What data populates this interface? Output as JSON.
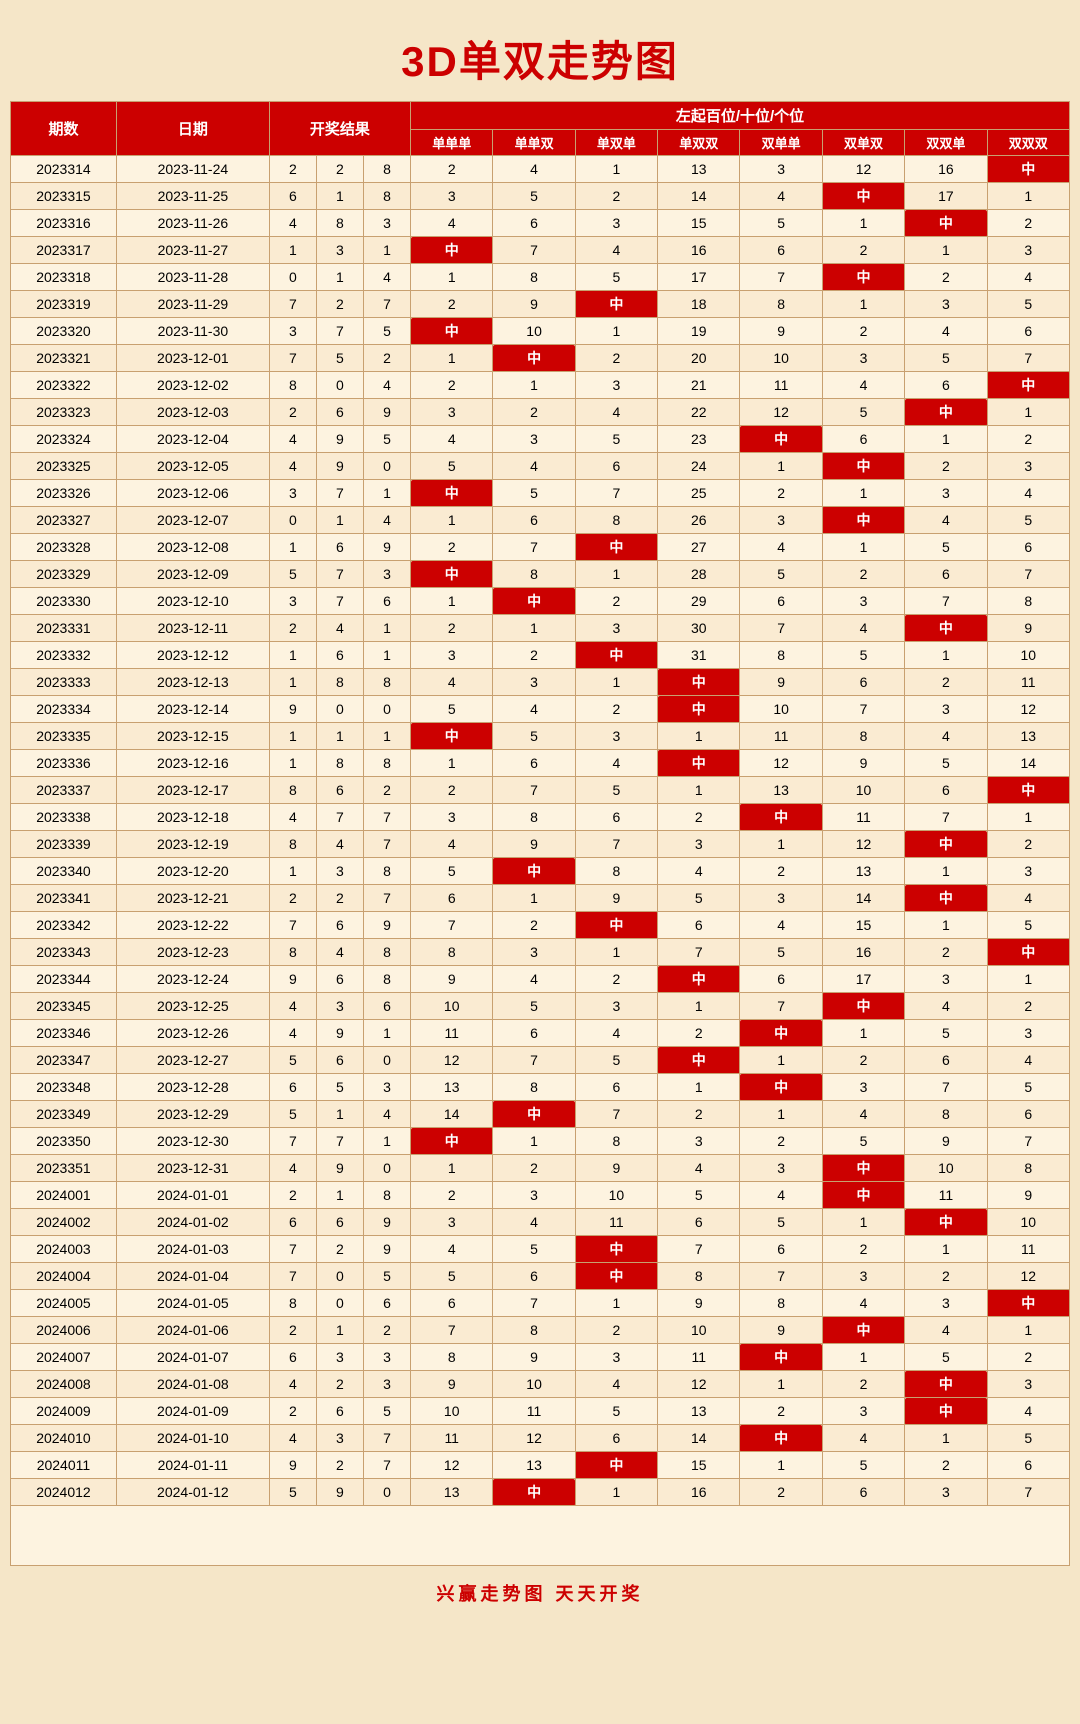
{
  "title": "3D单双走势图",
  "subtitle_left": "左起百位/十位/个位",
  "headers": {
    "qishu": "期数",
    "date": "日期",
    "result": "开奖结果",
    "cols": [
      "单单单",
      "单单双",
      "单双单",
      "单双双",
      "双单单",
      "双单双",
      "双双单",
      "双双双"
    ]
  },
  "footer": "兴赢走势图    天天开奖",
  "rows": [
    {
      "id": "2023314",
      "date": "2023-11-24",
      "r": [
        2,
        2,
        8
      ],
      "v": [
        2,
        4,
        1,
        13,
        3,
        12,
        16,
        "中"
      ]
    },
    {
      "id": "2023315",
      "date": "2023-11-25",
      "r": [
        6,
        1,
        8
      ],
      "v": [
        3,
        5,
        2,
        14,
        4,
        "中",
        17,
        1
      ]
    },
    {
      "id": "2023316",
      "date": "2023-11-26",
      "r": [
        4,
        8,
        3
      ],
      "v": [
        4,
        6,
        3,
        15,
        5,
        1,
        "中",
        2
      ]
    },
    {
      "id": "2023317",
      "date": "2023-11-27",
      "r": [
        1,
        3,
        1
      ],
      "v": [
        "中",
        7,
        4,
        16,
        6,
        2,
        1,
        3
      ]
    },
    {
      "id": "2023318",
      "date": "2023-11-28",
      "r": [
        0,
        1,
        4
      ],
      "v": [
        1,
        8,
        5,
        17,
        7,
        "中",
        2,
        4
      ]
    },
    {
      "id": "2023319",
      "date": "2023-11-29",
      "r": [
        7,
        2,
        7
      ],
      "v": [
        2,
        9,
        "中",
        18,
        8,
        1,
        3,
        5
      ]
    },
    {
      "id": "2023320",
      "date": "2023-11-30",
      "r": [
        3,
        7,
        5
      ],
      "v": [
        "中",
        10,
        1,
        19,
        9,
        2,
        4,
        6
      ]
    },
    {
      "id": "2023321",
      "date": "2023-12-01",
      "r": [
        7,
        5,
        2
      ],
      "v": [
        1,
        "中",
        2,
        20,
        10,
        3,
        5,
        7
      ]
    },
    {
      "id": "2023322",
      "date": "2023-12-02",
      "r": [
        8,
        0,
        4
      ],
      "v": [
        2,
        1,
        3,
        21,
        11,
        4,
        6,
        "中"
      ]
    },
    {
      "id": "2023323",
      "date": "2023-12-03",
      "r": [
        2,
        6,
        9
      ],
      "v": [
        3,
        2,
        4,
        22,
        12,
        5,
        "中",
        1
      ]
    },
    {
      "id": "2023324",
      "date": "2023-12-04",
      "r": [
        4,
        9,
        5
      ],
      "v": [
        4,
        3,
        5,
        23,
        "中",
        6,
        1,
        2
      ]
    },
    {
      "id": "2023325",
      "date": "2023-12-05",
      "r": [
        4,
        9,
        0
      ],
      "v": [
        5,
        4,
        6,
        24,
        1,
        "中",
        2,
        3
      ]
    },
    {
      "id": "2023326",
      "date": "2023-12-06",
      "r": [
        3,
        7,
        1
      ],
      "v": [
        "中",
        5,
        7,
        25,
        2,
        1,
        3,
        4
      ]
    },
    {
      "id": "2023327",
      "date": "2023-12-07",
      "r": [
        0,
        1,
        4
      ],
      "v": [
        1,
        6,
        8,
        26,
        3,
        "中",
        4,
        5
      ]
    },
    {
      "id": "2023328",
      "date": "2023-12-08",
      "r": [
        1,
        6,
        9
      ],
      "v": [
        2,
        7,
        "中",
        27,
        4,
        1,
        5,
        6
      ]
    },
    {
      "id": "2023329",
      "date": "2023-12-09",
      "r": [
        5,
        7,
        3
      ],
      "v": [
        "中",
        8,
        1,
        28,
        5,
        2,
        6,
        7
      ]
    },
    {
      "id": "2023330",
      "date": "2023-12-10",
      "r": [
        3,
        7,
        6
      ],
      "v": [
        1,
        "中",
        2,
        29,
        6,
        3,
        7,
        8
      ]
    },
    {
      "id": "2023331",
      "date": "2023-12-11",
      "r": [
        2,
        4,
        1
      ],
      "v": [
        2,
        1,
        3,
        30,
        7,
        4,
        "中",
        9
      ]
    },
    {
      "id": "2023332",
      "date": "2023-12-12",
      "r": [
        1,
        6,
        1
      ],
      "v": [
        3,
        2,
        "中",
        31,
        8,
        5,
        1,
        10
      ]
    },
    {
      "id": "2023333",
      "date": "2023-12-13",
      "r": [
        1,
        8,
        8
      ],
      "v": [
        4,
        3,
        1,
        "中",
        9,
        6,
        2,
        11
      ]
    },
    {
      "id": "2023334",
      "date": "2023-12-14",
      "r": [
        9,
        0,
        0
      ],
      "v": [
        5,
        4,
        2,
        "中",
        10,
        7,
        3,
        12
      ]
    },
    {
      "id": "2023335",
      "date": "2023-12-15",
      "r": [
        1,
        1,
        1
      ],
      "v": [
        "中",
        5,
        3,
        1,
        11,
        8,
        4,
        13
      ]
    },
    {
      "id": "2023336",
      "date": "2023-12-16",
      "r": [
        1,
        8,
        8
      ],
      "v": [
        1,
        6,
        4,
        "中",
        12,
        9,
        5,
        14
      ]
    },
    {
      "id": "2023337",
      "date": "2023-12-17",
      "r": [
        8,
        6,
        2
      ],
      "v": [
        2,
        7,
        5,
        1,
        13,
        10,
        6,
        "中"
      ]
    },
    {
      "id": "2023338",
      "date": "2023-12-18",
      "r": [
        4,
        7,
        7
      ],
      "v": [
        3,
        8,
        6,
        2,
        "中",
        11,
        7,
        1
      ]
    },
    {
      "id": "2023339",
      "date": "2023-12-19",
      "r": [
        8,
        4,
        7
      ],
      "v": [
        4,
        9,
        7,
        3,
        1,
        12,
        "中",
        2
      ]
    },
    {
      "id": "2023340",
      "date": "2023-12-20",
      "r": [
        1,
        3,
        8
      ],
      "v": [
        5,
        "中",
        8,
        4,
        2,
        13,
        1,
        3
      ]
    },
    {
      "id": "2023341",
      "date": "2023-12-21",
      "r": [
        2,
        2,
        7
      ],
      "v": [
        6,
        1,
        9,
        5,
        3,
        14,
        "中",
        4
      ]
    },
    {
      "id": "2023342",
      "date": "2023-12-22",
      "r": [
        7,
        6,
        9
      ],
      "v": [
        7,
        2,
        "中",
        6,
        4,
        15,
        1,
        5
      ]
    },
    {
      "id": "2023343",
      "date": "2023-12-23",
      "r": [
        8,
        4,
        8
      ],
      "v": [
        8,
        3,
        1,
        7,
        5,
        16,
        2,
        "中"
      ]
    },
    {
      "id": "2023344",
      "date": "2023-12-24",
      "r": [
        9,
        6,
        8
      ],
      "v": [
        9,
        4,
        2,
        "中",
        6,
        17,
        3,
        1
      ]
    },
    {
      "id": "2023345",
      "date": "2023-12-25",
      "r": [
        4,
        3,
        6
      ],
      "v": [
        10,
        5,
        3,
        1,
        7,
        "中",
        4,
        2
      ]
    },
    {
      "id": "2023346",
      "date": "2023-12-26",
      "r": [
        4,
        9,
        1
      ],
      "v": [
        11,
        6,
        4,
        2,
        "中",
        1,
        5,
        3
      ]
    },
    {
      "id": "2023347",
      "date": "2023-12-27",
      "r": [
        5,
        6,
        0
      ],
      "v": [
        12,
        7,
        5,
        "中",
        1,
        2,
        6,
        4
      ]
    },
    {
      "id": "2023348",
      "date": "2023-12-28",
      "r": [
        6,
        5,
        3
      ],
      "v": [
        13,
        8,
        6,
        1,
        "中",
        3,
        7,
        5
      ]
    },
    {
      "id": "2023349",
      "date": "2023-12-29",
      "r": [
        5,
        1,
        4
      ],
      "v": [
        14,
        "中",
        7,
        2,
        1,
        4,
        8,
        6
      ]
    },
    {
      "id": "2023350",
      "date": "2023-12-30",
      "r": [
        7,
        7,
        1
      ],
      "v": [
        "中",
        1,
        8,
        3,
        2,
        5,
        9,
        7
      ]
    },
    {
      "id": "2023351",
      "date": "2023-12-31",
      "r": [
        4,
        9,
        0
      ],
      "v": [
        1,
        2,
        9,
        4,
        3,
        "中",
        10,
        8
      ]
    },
    {
      "id": "2024001",
      "date": "2024-01-01",
      "r": [
        2,
        1,
        8
      ],
      "v": [
        2,
        3,
        10,
        5,
        4,
        "中",
        11,
        9
      ]
    },
    {
      "id": "2024002",
      "date": "2024-01-02",
      "r": [
        6,
        6,
        9
      ],
      "v": [
        3,
        4,
        11,
        6,
        5,
        1,
        "中",
        10
      ]
    },
    {
      "id": "2024003",
      "date": "2024-01-03",
      "r": [
        7,
        2,
        9
      ],
      "v": [
        4,
        5,
        "中",
        7,
        6,
        2,
        1,
        11
      ]
    },
    {
      "id": "2024004",
      "date": "2024-01-04",
      "r": [
        7,
        0,
        5
      ],
      "v": [
        5,
        6,
        "中",
        8,
        7,
        3,
        2,
        12
      ]
    },
    {
      "id": "2024005",
      "date": "2024-01-05",
      "r": [
        8,
        0,
        6
      ],
      "v": [
        6,
        7,
        1,
        9,
        8,
        4,
        3,
        "中"
      ]
    },
    {
      "id": "2024006",
      "date": "2024-01-06",
      "r": [
        2,
        1,
        2
      ],
      "v": [
        7,
        8,
        2,
        10,
        9,
        "中",
        4,
        1
      ]
    },
    {
      "id": "2024007",
      "date": "2024-01-07",
      "r": [
        6,
        3,
        3
      ],
      "v": [
        8,
        9,
        3,
        11,
        "中",
        1,
        5,
        2
      ]
    },
    {
      "id": "2024008",
      "date": "2024-01-08",
      "r": [
        4,
        2,
        3
      ],
      "v": [
        9,
        10,
        4,
        12,
        1,
        2,
        "中",
        3
      ]
    },
    {
      "id": "2024009",
      "date": "2024-01-09",
      "r": [
        2,
        6,
        5
      ],
      "v": [
        10,
        11,
        5,
        13,
        2,
        3,
        "中",
        4
      ]
    },
    {
      "id": "2024010",
      "date": "2024-01-10",
      "r": [
        4,
        3,
        7
      ],
      "v": [
        11,
        12,
        6,
        14,
        "中",
        4,
        1,
        5
      ]
    },
    {
      "id": "2024011",
      "date": "2024-01-11",
      "r": [
        9,
        2,
        7
      ],
      "v": [
        12,
        13,
        "中",
        15,
        1,
        5,
        2,
        6
      ]
    },
    {
      "id": "2024012",
      "date": "2024-01-12",
      "r": [
        5,
        9,
        0
      ],
      "v": [
        13,
        "中",
        1,
        16,
        2,
        6,
        3,
        7
      ]
    }
  ]
}
